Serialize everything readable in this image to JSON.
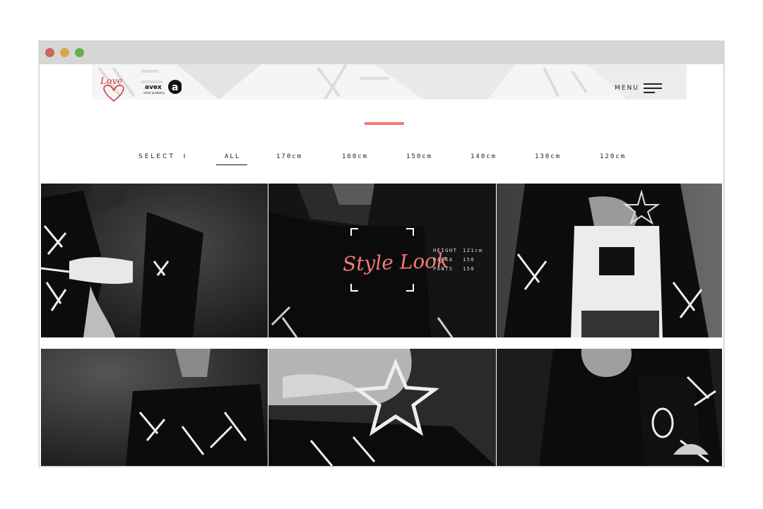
{
  "brand": {
    "love_logo_text": "Love",
    "avex_logo_text": "avex",
    "avex_sub_text": "artist academy"
  },
  "header": {
    "menu_label": "MENU"
  },
  "filters": {
    "select_label": "SELECT",
    "items": [
      {
        "label": "ALL",
        "active": true
      },
      {
        "label": "170cm",
        "active": false
      },
      {
        "label": "160cm",
        "active": false
      },
      {
        "label": "150cm",
        "active": false
      },
      {
        "label": "140cm",
        "active": false
      },
      {
        "label": "130cm",
        "active": false
      },
      {
        "label": "120cm",
        "active": false
      }
    ]
  },
  "featured": {
    "title": "Style Look",
    "specs": [
      {
        "key": "HEIGHT",
        "value": "121cm"
      },
      {
        "key": "PARKA",
        "value": "150"
      },
      {
        "key": "PANTS",
        "value": "150"
      }
    ]
  },
  "colors": {
    "accent": "#f47a73",
    "chrome": "#d6d6d6",
    "dark": "#0f0f0f"
  }
}
